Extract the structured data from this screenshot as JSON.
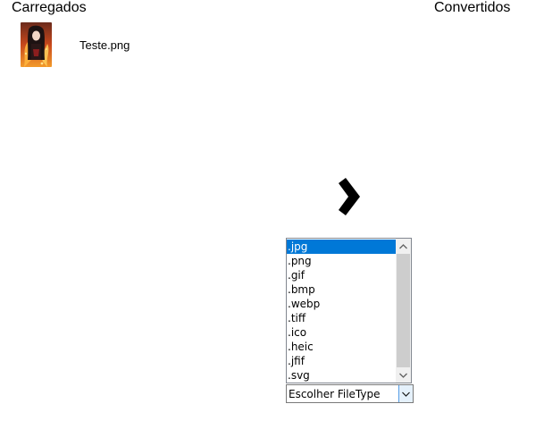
{
  "headers": {
    "loaded": "Carregados",
    "converted": "Convertidos"
  },
  "loaded_files": [
    {
      "name": "Teste.png",
      "thumbnail_icon": "image-thumbnail-icon"
    }
  ],
  "arrow_icon": "chevron-right-icon",
  "filetype_list": {
    "items": [
      ".jpg",
      ".png",
      ".gif",
      ".bmp",
      ".webp",
      ".tiff",
      ".ico",
      ".heic",
      ".jfif",
      ".svg"
    ],
    "selected": ".jpg"
  },
  "filetype_select": {
    "value": "Escolher FileType"
  },
  "colors": {
    "selection": "#0078d7",
    "scrollbar_track": "#f0f0f0",
    "scrollbar_thumb": "#cdcdcd",
    "combo_button": "#e5f1fb",
    "combo_button_border": "#569de5"
  }
}
